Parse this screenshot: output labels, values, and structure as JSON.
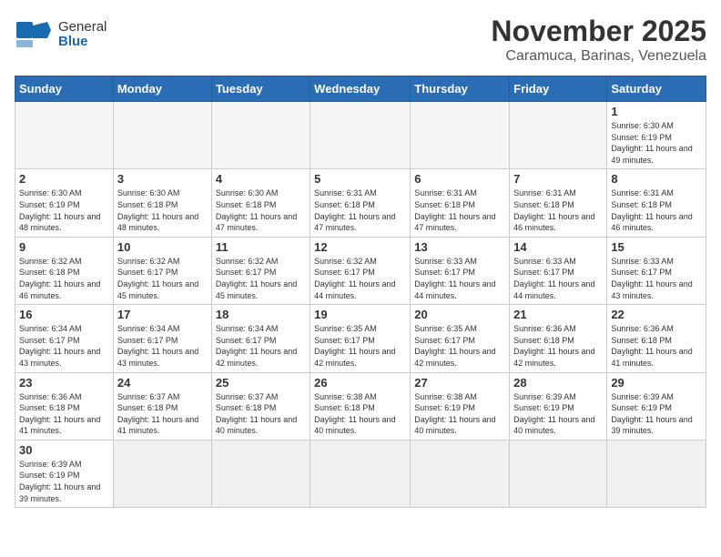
{
  "header": {
    "title": "November 2025",
    "location": "Caramuca, Barinas, Venezuela",
    "logo_general": "General",
    "logo_blue": "Blue"
  },
  "days_of_week": [
    "Sunday",
    "Monday",
    "Tuesday",
    "Wednesday",
    "Thursday",
    "Friday",
    "Saturday"
  ],
  "weeks": [
    [
      {
        "day": "",
        "info": ""
      },
      {
        "day": "",
        "info": ""
      },
      {
        "day": "",
        "info": ""
      },
      {
        "day": "",
        "info": ""
      },
      {
        "day": "",
        "info": ""
      },
      {
        "day": "",
        "info": ""
      },
      {
        "day": "1",
        "info": "Sunrise: 6:30 AM\nSunset: 6:19 PM\nDaylight: 11 hours and 49 minutes."
      }
    ],
    [
      {
        "day": "2",
        "info": "Sunrise: 6:30 AM\nSunset: 6:19 PM\nDaylight: 11 hours and 48 minutes."
      },
      {
        "day": "3",
        "info": "Sunrise: 6:30 AM\nSunset: 6:18 PM\nDaylight: 11 hours and 48 minutes."
      },
      {
        "day": "4",
        "info": "Sunrise: 6:30 AM\nSunset: 6:18 PM\nDaylight: 11 hours and 47 minutes."
      },
      {
        "day": "5",
        "info": "Sunrise: 6:31 AM\nSunset: 6:18 PM\nDaylight: 11 hours and 47 minutes."
      },
      {
        "day": "6",
        "info": "Sunrise: 6:31 AM\nSunset: 6:18 PM\nDaylight: 11 hours and 47 minutes."
      },
      {
        "day": "7",
        "info": "Sunrise: 6:31 AM\nSunset: 6:18 PM\nDaylight: 11 hours and 46 minutes."
      },
      {
        "day": "8",
        "info": "Sunrise: 6:31 AM\nSunset: 6:18 PM\nDaylight: 11 hours and 46 minutes."
      }
    ],
    [
      {
        "day": "9",
        "info": "Sunrise: 6:32 AM\nSunset: 6:18 PM\nDaylight: 11 hours and 46 minutes."
      },
      {
        "day": "10",
        "info": "Sunrise: 6:32 AM\nSunset: 6:17 PM\nDaylight: 11 hours and 45 minutes."
      },
      {
        "day": "11",
        "info": "Sunrise: 6:32 AM\nSunset: 6:17 PM\nDaylight: 11 hours and 45 minutes."
      },
      {
        "day": "12",
        "info": "Sunrise: 6:32 AM\nSunset: 6:17 PM\nDaylight: 11 hours and 44 minutes."
      },
      {
        "day": "13",
        "info": "Sunrise: 6:33 AM\nSunset: 6:17 PM\nDaylight: 11 hours and 44 minutes."
      },
      {
        "day": "14",
        "info": "Sunrise: 6:33 AM\nSunset: 6:17 PM\nDaylight: 11 hours and 44 minutes."
      },
      {
        "day": "15",
        "info": "Sunrise: 6:33 AM\nSunset: 6:17 PM\nDaylight: 11 hours and 43 minutes."
      }
    ],
    [
      {
        "day": "16",
        "info": "Sunrise: 6:34 AM\nSunset: 6:17 PM\nDaylight: 11 hours and 43 minutes."
      },
      {
        "day": "17",
        "info": "Sunrise: 6:34 AM\nSunset: 6:17 PM\nDaylight: 11 hours and 43 minutes."
      },
      {
        "day": "18",
        "info": "Sunrise: 6:34 AM\nSunset: 6:17 PM\nDaylight: 11 hours and 42 minutes."
      },
      {
        "day": "19",
        "info": "Sunrise: 6:35 AM\nSunset: 6:17 PM\nDaylight: 11 hours and 42 minutes."
      },
      {
        "day": "20",
        "info": "Sunrise: 6:35 AM\nSunset: 6:17 PM\nDaylight: 11 hours and 42 minutes."
      },
      {
        "day": "21",
        "info": "Sunrise: 6:36 AM\nSunset: 6:18 PM\nDaylight: 11 hours and 42 minutes."
      },
      {
        "day": "22",
        "info": "Sunrise: 6:36 AM\nSunset: 6:18 PM\nDaylight: 11 hours and 41 minutes."
      }
    ],
    [
      {
        "day": "23",
        "info": "Sunrise: 6:36 AM\nSunset: 6:18 PM\nDaylight: 11 hours and 41 minutes."
      },
      {
        "day": "24",
        "info": "Sunrise: 6:37 AM\nSunset: 6:18 PM\nDaylight: 11 hours and 41 minutes."
      },
      {
        "day": "25",
        "info": "Sunrise: 6:37 AM\nSunset: 6:18 PM\nDaylight: 11 hours and 40 minutes."
      },
      {
        "day": "26",
        "info": "Sunrise: 6:38 AM\nSunset: 6:18 PM\nDaylight: 11 hours and 40 minutes."
      },
      {
        "day": "27",
        "info": "Sunrise: 6:38 AM\nSunset: 6:19 PM\nDaylight: 11 hours and 40 minutes."
      },
      {
        "day": "28",
        "info": "Sunrise: 6:39 AM\nSunset: 6:19 PM\nDaylight: 11 hours and 40 minutes."
      },
      {
        "day": "29",
        "info": "Sunrise: 6:39 AM\nSunset: 6:19 PM\nDaylight: 11 hours and 39 minutes."
      }
    ],
    [
      {
        "day": "30",
        "info": "Sunrise: 6:39 AM\nSunset: 6:19 PM\nDaylight: 11 hours and 39 minutes."
      },
      {
        "day": "",
        "info": ""
      },
      {
        "day": "",
        "info": ""
      },
      {
        "day": "",
        "info": ""
      },
      {
        "day": "",
        "info": ""
      },
      {
        "day": "",
        "info": ""
      },
      {
        "day": "",
        "info": ""
      }
    ]
  ]
}
